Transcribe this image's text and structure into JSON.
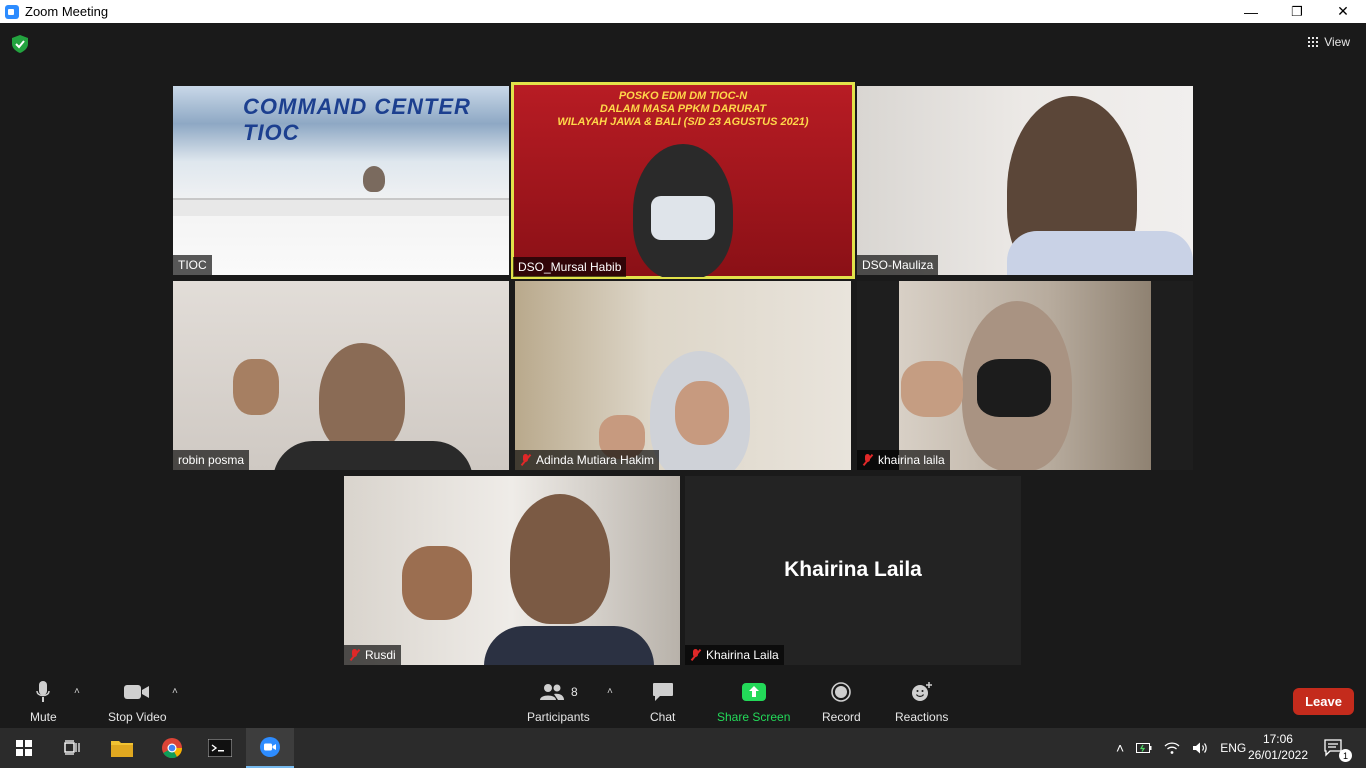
{
  "window": {
    "title": "Zoom Meeting",
    "controls": {
      "minimize": "—",
      "maximize": "❐",
      "close": "✕"
    }
  },
  "header": {
    "view_label": "View"
  },
  "tiles": [
    {
      "name": "TIOC",
      "muted": false,
      "banner": "COMMAND CENTER TIOC"
    },
    {
      "name": "DSO_Mursal Habib",
      "muted": false,
      "active_speaker": true,
      "banner_lines": [
        "POSKO EDM DM TIOC-N",
        "DALAM MASA PPKM DARURAT",
        "WILAYAH JAWA & BALI (S/D 23 AGUSTUS 2021)"
      ]
    },
    {
      "name": "DSO-Mauliza",
      "muted": false
    },
    {
      "name": "robin posma",
      "muted": false
    },
    {
      "name": "Adinda Mutiara Hakim",
      "muted": true
    },
    {
      "name": "khairina laila",
      "muted": true
    },
    {
      "name": "Rusdi",
      "muted": true
    },
    {
      "name": "Khairina Laila",
      "muted": true,
      "avatar_text": "Khairina Laila"
    }
  ],
  "controls": {
    "mute": "Mute",
    "stop_video": "Stop Video",
    "participants": "Participants",
    "participants_count": "8",
    "chat": "Chat",
    "share_screen": "Share Screen",
    "record": "Record",
    "reactions": "Reactions",
    "leave": "Leave",
    "colors": {
      "share_green": "#23d959",
      "leave_red": "#c42b1c",
      "active_speaker": "#e2e24a"
    }
  },
  "taskbar": {
    "language": "ENG",
    "time": "17:06",
    "date": "26/01/2022",
    "notification_count": "1"
  }
}
